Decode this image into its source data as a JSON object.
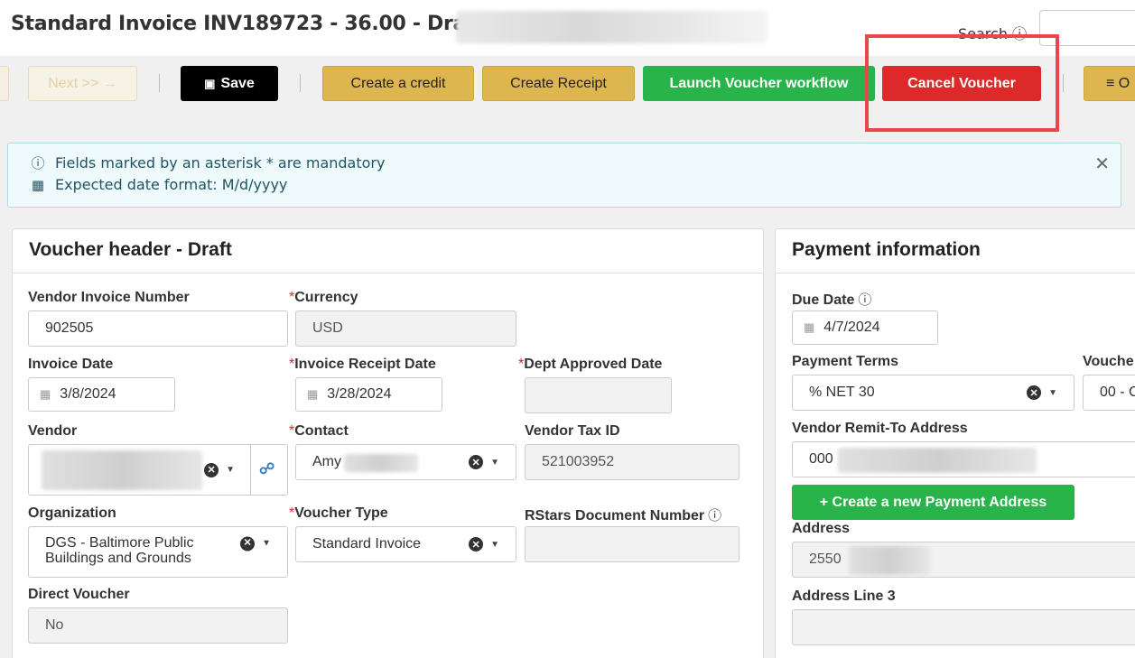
{
  "header": {
    "title": "Standard Invoice INV189723 - 36.00 - Draft -",
    "search_label": "Search"
  },
  "toolbar": {
    "next_label": "Next >> →",
    "save_label": "Save",
    "create_credit_label": "Create a credit",
    "create_receipt_label": "Create Receipt",
    "launch_workflow_label": "Launch Voucher workflow",
    "cancel_voucher_label": "Cancel Voucher",
    "more_label": "≡ O"
  },
  "alert": {
    "line1": "Fields marked by an asterisk * are mandatory",
    "line2": "Expected date format: M/d/yyyy"
  },
  "voucher_header": {
    "title": "Voucher header - Draft",
    "vendor_invoice_number_label": "Vendor Invoice Number",
    "vendor_invoice_number": "902505",
    "currency_label": "Currency",
    "currency": "USD",
    "invoice_date_label": "Invoice Date",
    "invoice_date": "3/8/2024",
    "invoice_receipt_date_label": "Invoice Receipt Date",
    "invoice_receipt_date": "3/28/2024",
    "dept_approved_date_label": "Dept Approved Date",
    "dept_approved_date": "",
    "vendor_label": "Vendor",
    "contact_label": "Contact",
    "contact": "Amy",
    "vendor_tax_id_label": "Vendor Tax ID",
    "vendor_tax_id": "521003952",
    "organization_label": "Organization",
    "organization": "DGS - Baltimore Public Buildings and Grounds",
    "organization_line1": "DGS - Baltimore Public",
    "organization_line2": "Buildings and Grounds",
    "voucher_type_label": "Voucher Type",
    "voucher_type": "Standard Invoice",
    "rstars_label": "RStars Document Number",
    "rstars": "",
    "direct_voucher_label": "Direct Voucher",
    "direct_voucher": "No"
  },
  "payment": {
    "title": "Payment information",
    "due_date_label": "Due Date",
    "due_date": "4/7/2024",
    "payment_terms_label": "Payment Terms",
    "payment_terms": "% NET 30",
    "voucher_label_partial": "Vouche",
    "voucher_value_partial": "00 - C",
    "remit_label": "Vendor Remit-To Address",
    "remit_value": "000",
    "new_address_label": "+ Create a new Payment Address",
    "address_label": "Address",
    "address_value": "2550",
    "address_line3_label": "Address Line 3",
    "address_line3": ""
  }
}
